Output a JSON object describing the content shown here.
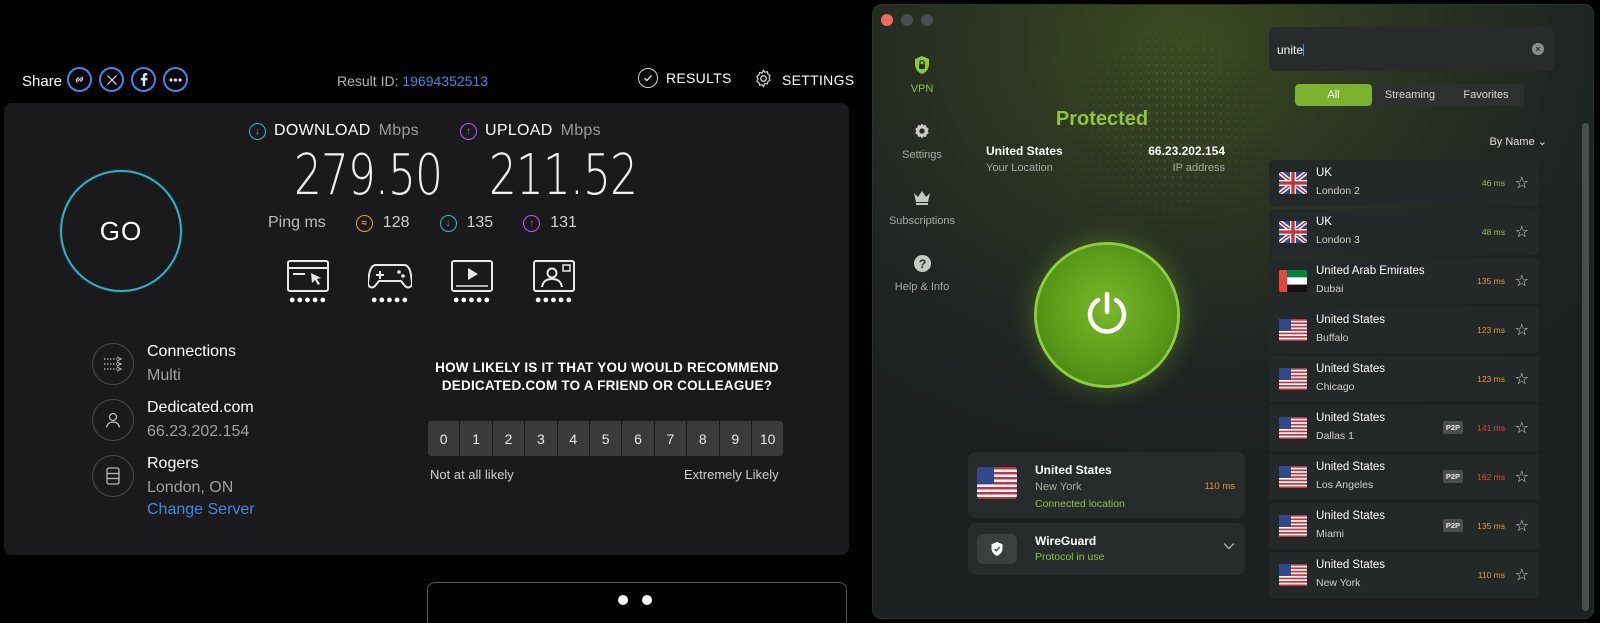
{
  "speedtest": {
    "share_label": "Share",
    "share_icons": [
      "link-icon",
      "x-icon",
      "facebook-icon",
      "more-icon"
    ],
    "result_label": "Result ID:",
    "result_id": "19694352513",
    "nav": {
      "results": "RESULTS",
      "settings": "SETTINGS"
    },
    "go_label": "GO",
    "download": {
      "label": "DOWNLOAD",
      "unit": "Mbps",
      "value": "279.50"
    },
    "upload": {
      "label": "UPLOAD",
      "unit": "Mbps",
      "value": "211.52"
    },
    "ping": {
      "label": "Ping ms",
      "idle": "128",
      "down": "135",
      "up": "131"
    },
    "quality_icons": [
      "web-browsing-icon",
      "gaming-icon",
      "video-streaming-icon",
      "video-call-icon"
    ],
    "connections": {
      "title": "Connections",
      "value": "Multi"
    },
    "host": {
      "title": "Dedicated.com",
      "value": "66.23.202.154"
    },
    "server": {
      "title": "Rogers",
      "value": "London, ON"
    },
    "change_server": "Change Server",
    "nps": {
      "question": "HOW LIKELY IS IT THAT YOU WOULD RECOMMEND DEDICATED.COM TO A FRIEND OR COLLEAGUE?",
      "scale": [
        "0",
        "1",
        "2",
        "3",
        "4",
        "5",
        "6",
        "7",
        "8",
        "9",
        "10"
      ],
      "low": "Not at all likely",
      "high": "Extremely Likely"
    }
  },
  "vpn": {
    "sidebar": [
      {
        "label": "VPN",
        "icon": "shield-lock-icon"
      },
      {
        "label": "Settings",
        "icon": "gear-icon"
      },
      {
        "label": "Subscriptions",
        "icon": "crown-icon"
      },
      {
        "label": "Help & Info",
        "icon": "help-icon"
      }
    ],
    "status": "Protected",
    "location": {
      "value": "United States",
      "label": "Your Location"
    },
    "ip": {
      "value": "66.23.202.154",
      "label": "IP address"
    },
    "connected": {
      "country": "United States",
      "city": "New York",
      "status": "Connected location",
      "ms": "110 ms"
    },
    "protocol": {
      "name": "WireGuard",
      "sub": "Protocol in use"
    },
    "search": {
      "value": "unite"
    },
    "tabs": [
      "All",
      "Streaming",
      "Favorites"
    ],
    "sort_label": "By Name",
    "servers": [
      {
        "country": "UK",
        "city": "London 2",
        "ms": "46 ms",
        "flag": "uk",
        "p2p": "",
        "color": "#8dc63f"
      },
      {
        "country": "UK",
        "city": "London 3",
        "ms": "48 ms",
        "flag": "uk",
        "p2p": "",
        "color": "#8dc63f"
      },
      {
        "country": "United Arab Emirates",
        "city": "Dubai",
        "ms": "135 ms",
        "flag": "uae",
        "p2p": "",
        "color": "#e49b2d"
      },
      {
        "country": "United States",
        "city": "Buffalo",
        "ms": "123 ms",
        "flag": "us",
        "p2p": "",
        "color": "#e49b2d"
      },
      {
        "country": "United States",
        "city": "Chicago",
        "ms": "123 ms",
        "flag": "us",
        "p2p": "",
        "color": "#e49b2d"
      },
      {
        "country": "United States",
        "city": "Dallas 1",
        "ms": "141 ms",
        "flag": "us",
        "p2p": "P2P",
        "color": "#e8453c"
      },
      {
        "country": "United States",
        "city": "Los Angeles",
        "ms": "162 ms",
        "flag": "us",
        "p2p": "P2P",
        "color": "#e8453c"
      },
      {
        "country": "United States",
        "city": "Miami",
        "ms": "135 ms",
        "flag": "us",
        "p2p": "P2P",
        "color": "#e49b2d"
      },
      {
        "country": "United States",
        "city": "New York",
        "ms": "110 ms",
        "flag": "us",
        "p2p": "",
        "color": "#e49b2d"
      }
    ]
  }
}
